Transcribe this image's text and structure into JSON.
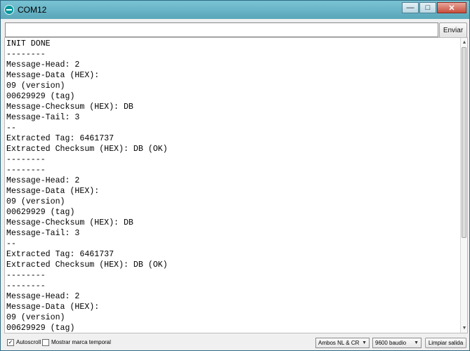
{
  "window": {
    "title": "COM12",
    "controls": {
      "minimize": "—",
      "maximize": "□",
      "close": "✕"
    }
  },
  "send": {
    "input_value": "",
    "button_label": "Enviar"
  },
  "output": {
    "lines": [
      "INIT DONE",
      "--------",
      "Message-Head: 2",
      "Message-Data (HEX):",
      "09 (version)",
      "00629929 (tag)",
      "Message-Checksum (HEX): DB",
      "Message-Tail: 3",
      "--",
      "Extracted Tag: 6461737",
      "Extracted Checksum (HEX): DB (OK)",
      "--------",
      "--------",
      "Message-Head: 2",
      "Message-Data (HEX):",
      "09 (version)",
      "00629929 (tag)",
      "Message-Checksum (HEX): DB",
      "Message-Tail: 3",
      "--",
      "Extracted Tag: 6461737",
      "Extracted Checksum (HEX): DB (OK)",
      "--------",
      "--------",
      "Message-Head: 2",
      "Message-Data (HEX):",
      "09 (version)",
      "00629929 (tag)"
    ]
  },
  "bottom": {
    "autoscroll_label": "Autoscroll",
    "autoscroll_checked": true,
    "timestamp_label": "Mostrar marca temporal",
    "timestamp_checked": false,
    "line_ending": "Ambos NL & CR",
    "baud_rate": "9600 baudio",
    "clear_label": "Limpiar salida"
  },
  "colors": {
    "titlebar": "#5aa6ba",
    "arduino_teal": "#00979c"
  }
}
